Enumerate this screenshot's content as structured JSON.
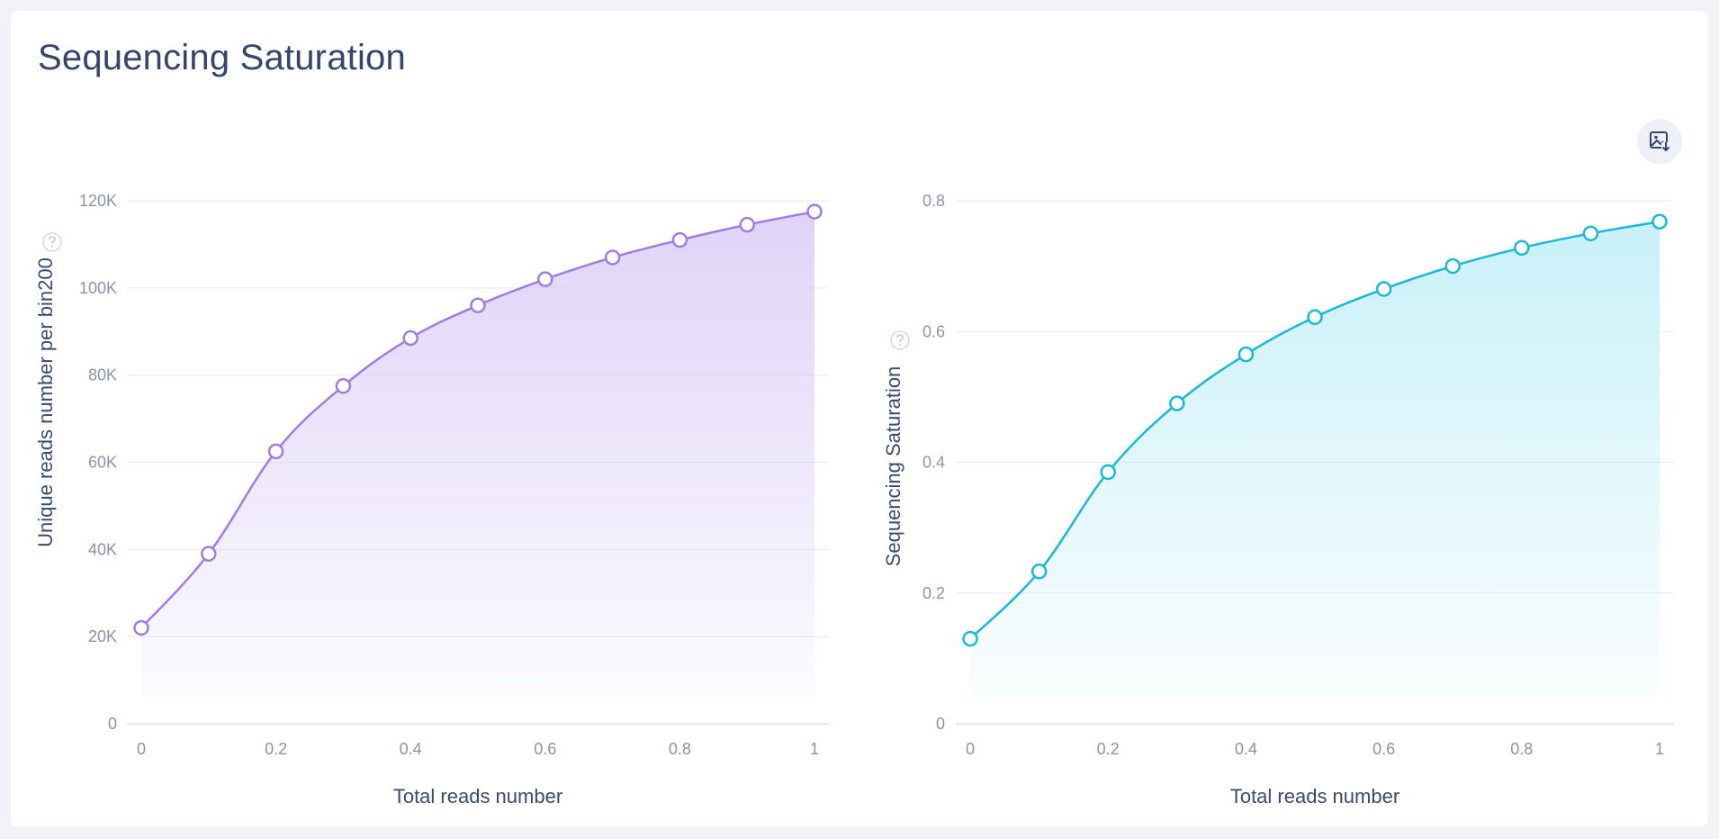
{
  "page": {
    "title": "Sequencing Saturation"
  },
  "toolbar": {
    "download_icon": "image-download-icon"
  },
  "chart_data": [
    {
      "type": "area",
      "title": "",
      "xlabel": "Total reads number",
      "ylabel": "Unique reads number per bin200",
      "x": [
        0,
        0.1,
        0.2,
        0.3,
        0.4,
        0.5,
        0.6,
        0.7,
        0.8,
        0.9,
        1
      ],
      "values": [
        22000,
        39000,
        62500,
        77500,
        88500,
        96000,
        102000,
        107000,
        111000,
        114500,
        117500
      ],
      "xticks": [
        0,
        0.2,
        0.4,
        0.6,
        0.8,
        1
      ],
      "xtick_labels": [
        "0",
        "0.2",
        "0.4",
        "0.6",
        "0.8",
        "1"
      ],
      "yticks": [
        0,
        20000,
        40000,
        60000,
        80000,
        100000,
        120000
      ],
      "ytick_labels": [
        "0",
        "20K",
        "40K",
        "60K",
        "80K",
        "100K",
        "120K"
      ],
      "xlim": [
        0,
        1
      ],
      "ylim": [
        0,
        120000
      ],
      "grid": "horizontal",
      "color": "#a07de6",
      "fill_color": "#d9ccf6"
    },
    {
      "type": "area",
      "title": "",
      "xlabel": "Total reads number",
      "ylabel": "Sequencing Saturation",
      "x": [
        0,
        0.1,
        0.2,
        0.3,
        0.4,
        0.5,
        0.6,
        0.7,
        0.8,
        0.9,
        1
      ],
      "values": [
        0.13,
        0.233,
        0.385,
        0.49,
        0.565,
        0.622,
        0.665,
        0.7,
        0.728,
        0.75,
        0.768
      ],
      "xticks": [
        0,
        0.2,
        0.4,
        0.6,
        0.8,
        1
      ],
      "xtick_labels": [
        "0",
        "0.2",
        "0.4",
        "0.6",
        "0.8",
        "1"
      ],
      "yticks": [
        0,
        0.2,
        0.4,
        0.6,
        0.8
      ],
      "ytick_labels": [
        "0",
        "0.2",
        "0.4",
        "0.6",
        "0.8"
      ],
      "xlim": [
        0,
        1
      ],
      "ylim": [
        0,
        0.8
      ],
      "grid": "horizontal",
      "color": "#1ab9d8",
      "fill_color": "#bfeef7"
    }
  ]
}
